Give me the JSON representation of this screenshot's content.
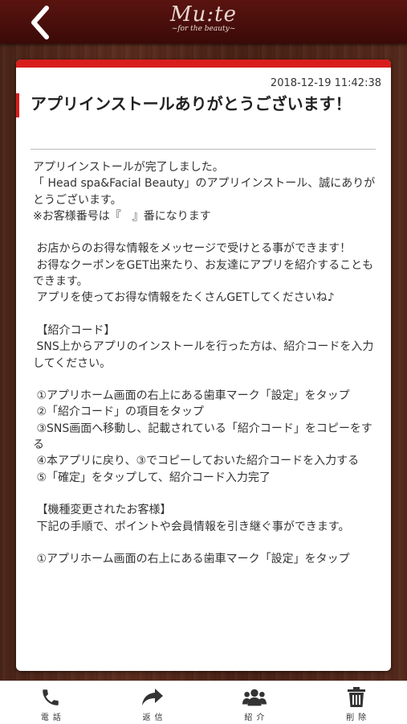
{
  "header": {
    "back_icon": "chevron-left-icon",
    "logo_text": "Mu:te",
    "logo_subtitle": "~for the beauty~"
  },
  "message": {
    "timestamp": "2018-12-19 11:42:38",
    "title": "アプリインストールありがとうございます！",
    "body": "アプリインストールが完了しました。\n「 Head spa&Facial Beauty」のアプリインストール、誠にありがとうございます。\n※お客様番号は『　』番になります\n\n お店からのお得な情報をメッセージで受けとる事ができます！\n お得なクーポンをGET出来たり、お友達にアプリを紹介することもできます。\n アプリを使ってお得な情報をたくさんGETしてくださいね♪\n\n 【紹介コード】\n SNS上からアプリのインストールを行った方は、紹介コードを入力してください。\n\n ①アプリホーム画面の右上にある歯車マーク「設定」をタップ\n ②「紹介コード」の項目をタップ\n ③SNS画面へ移動し、記載されている「紹介コード」をコピーをする\n ④本アプリに戻り、③でコピーしておいた紹介コードを入力する\n ⑤「確定」をタップして、紹介コード入力完了\n\n 【機種変更されたお客様】\n 下記の手順で、ポイントや会員情報を引き継ぐ事ができます。\n\n ①アプリホーム画面の右上にある歯車マーク「設定」をタップ"
  },
  "bottom_nav": {
    "items": [
      {
        "label": "電話",
        "icon": "phone-icon"
      },
      {
        "label": "返信",
        "icon": "reply-arrow-icon"
      },
      {
        "label": "紹介",
        "icon": "users-icon"
      },
      {
        "label": "削除",
        "icon": "trash-icon"
      }
    ]
  },
  "colors": {
    "header_bg": "#4a0e0b",
    "accent_red": "#d81d1d",
    "wood": "#4f2619",
    "card_bg": "#ffffff"
  }
}
